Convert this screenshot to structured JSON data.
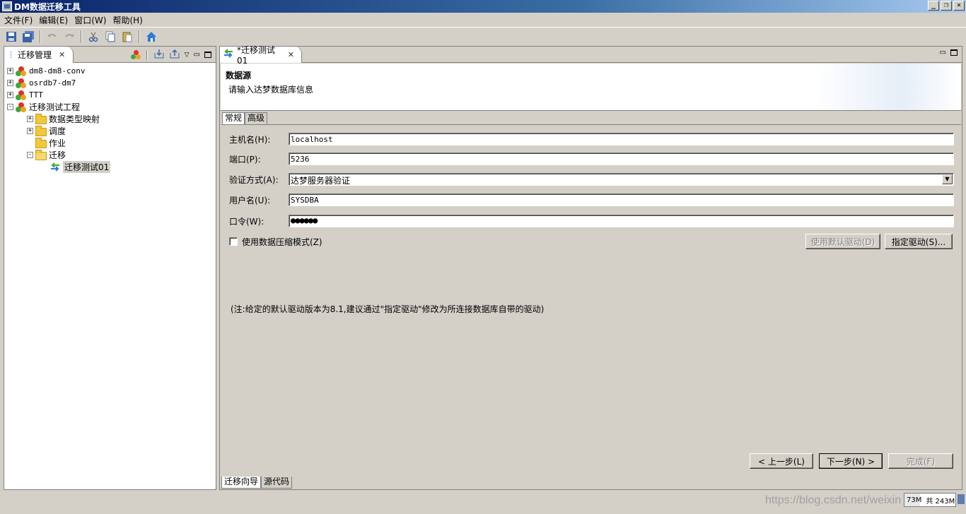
{
  "window": {
    "title": "DM数据迁移工具"
  },
  "menu": [
    {
      "label": "文件(F)"
    },
    {
      "label": "编辑(E)"
    },
    {
      "label": "窗口(W)"
    },
    {
      "label": "帮助(H)"
    }
  ],
  "toolbar": {
    "icons": [
      "save-icon",
      "save-all-icon",
      "undo-icon",
      "redo-icon",
      "cut-icon",
      "copy-icon",
      "paste-icon",
      "home-icon"
    ]
  },
  "left_view": {
    "tab_label": "迁移管理",
    "tree": [
      {
        "label": "dm8-dm8-conv",
        "level": 0,
        "expander": "+",
        "icon": "db"
      },
      {
        "label": "osrdb7-dm7",
        "level": 0,
        "expander": "+",
        "icon": "db"
      },
      {
        "label": "TTT",
        "level": 0,
        "expander": "+",
        "icon": "db"
      },
      {
        "label": "迁移测试工程",
        "level": 0,
        "expander": "-",
        "icon": "db"
      },
      {
        "label": "数据类型映射",
        "level": 1,
        "expander": "+",
        "icon": "folder"
      },
      {
        "label": "调度",
        "level": 1,
        "expander": "+",
        "icon": "folder"
      },
      {
        "label": "作业",
        "level": 1,
        "expander": "",
        "icon": "folder"
      },
      {
        "label": "迁移",
        "level": 1,
        "expander": "-",
        "icon": "folder-open"
      },
      {
        "label": "迁移测试01",
        "level": 2,
        "expander": "",
        "icon": "migrate",
        "selected": true
      }
    ]
  },
  "editor": {
    "tab_label": "*迁移测试01",
    "header_title": "数据源",
    "header_desc": "请输入达梦数据库信息",
    "sub_tabs": [
      "常规",
      "高级"
    ],
    "fields": {
      "host_label": "主机名(H):",
      "host_value": "localhost",
      "port_label": "端口(P):",
      "port_value": "5236",
      "auth_label": "验证方式(A):",
      "auth_value": "达梦服务器验证",
      "user_label": "用户名(U):",
      "user_value": "SYSDBA",
      "pwd_label": "口令(W):",
      "pwd_value": "●●●●●●"
    },
    "compress_label": "使用数据压缩模式(Z)",
    "default_driver_label": "使用默认驱动(D)",
    "specify_driver_label": "指定驱动(S)...",
    "note": "(注:给定的默认驱动版本为8.1,建议通过\"指定驱动\"修改为所连接数据库自带的驱动)",
    "prev_label": "< 上一步(L)",
    "next_label": "下一步(N) >",
    "finish_label": "完成(F)",
    "bottom_tabs": [
      "迁移向导",
      "源代码"
    ]
  },
  "status": {
    "watermark": "https://blog.csdn.net/weixin",
    "mem_used": "73M",
    "mem_total": "共 243M",
    "mem_fraction": 0.3
  },
  "colors": {
    "titlebar": "#0a246a",
    "chrome": "#d4d0c8",
    "db_red": "#e0302a",
    "db_green": "#3aa83a",
    "db_orange": "#f0a020",
    "home_blue": "#2e7bd6"
  }
}
